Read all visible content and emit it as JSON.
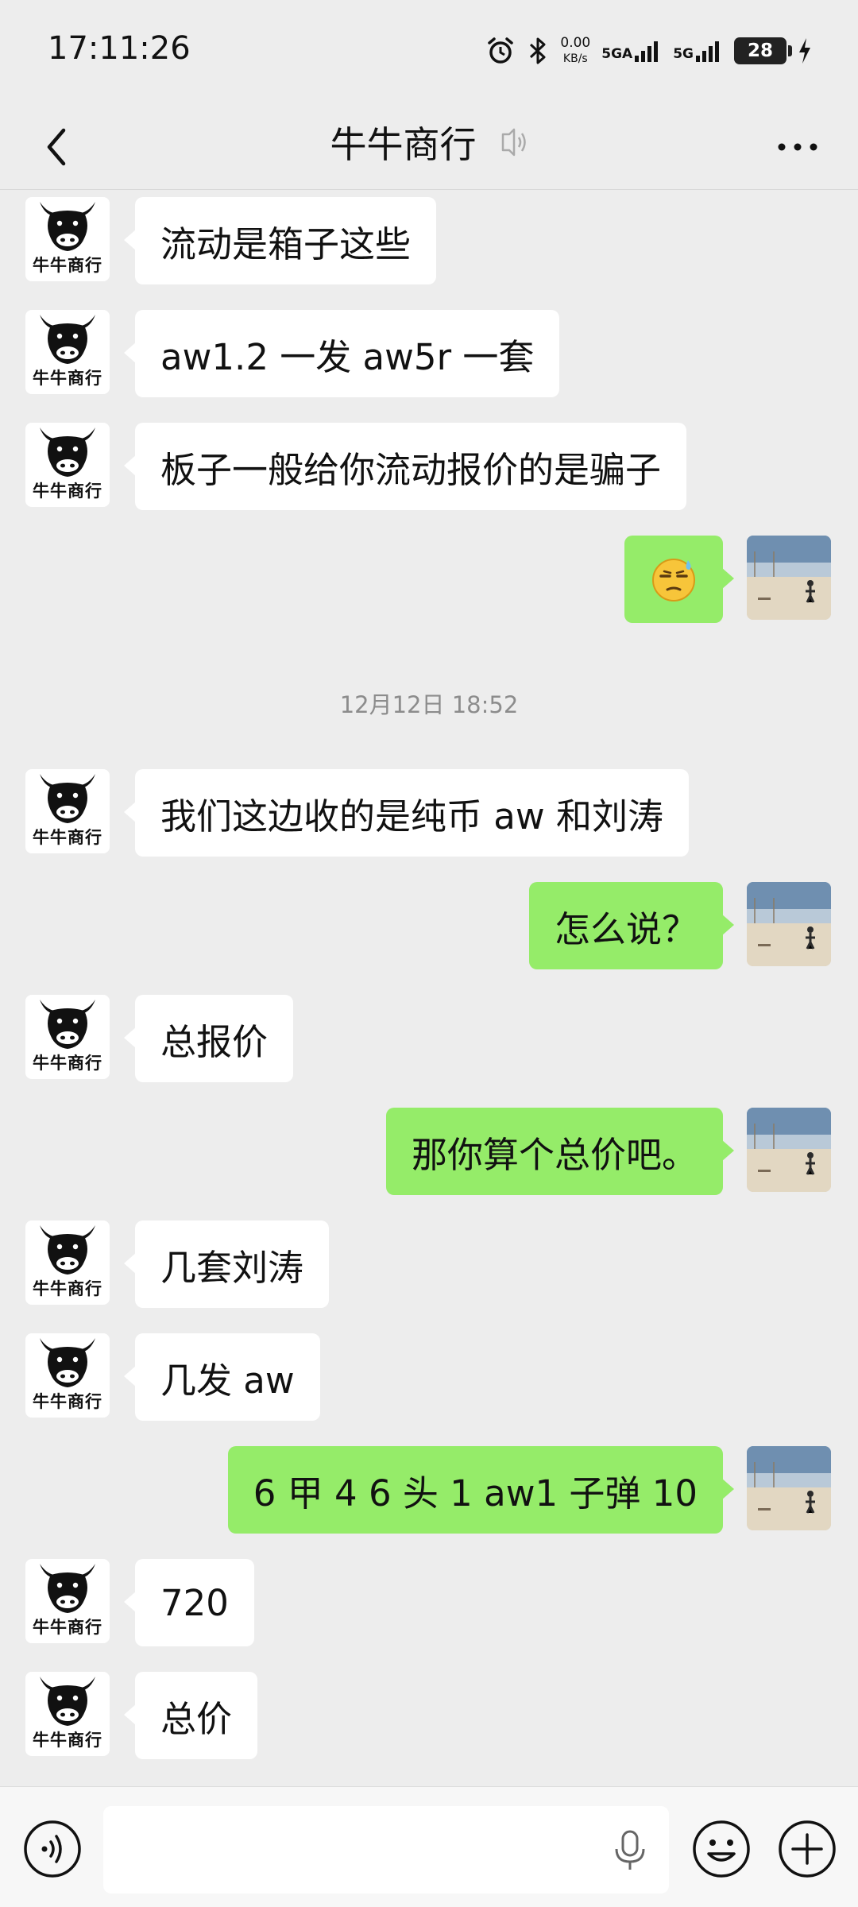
{
  "status_bar": {
    "time": "17:11:26",
    "net_speed_value": "0.00",
    "net_speed_unit": "KB/s",
    "signal_1_label": "5GA",
    "signal_2_label": "5G",
    "battery": "28",
    "icons": [
      "alarm-icon",
      "bluetooth-icon",
      "signal-icon",
      "charging-icon"
    ]
  },
  "header": {
    "title": "牛牛商行",
    "back_icon": "chevron-left-icon",
    "speaker_icon": "speaker-mode-icon",
    "more_icon": "more-dots-icon"
  },
  "contact": {
    "avatar_label": "牛牛商行"
  },
  "timestamp": "12月12日  18:52",
  "messages": [
    {
      "side": "in",
      "text": "流动是箱子这些"
    },
    {
      "side": "in",
      "text": "aw1.2 一发  aw5r 一套"
    },
    {
      "side": "in",
      "text": "板子一般给你流动报价的是骗子"
    },
    {
      "side": "out",
      "text": "",
      "emoji": "sweat-smile-emoji"
    },
    {
      "side": "in",
      "text": "我们这边收的是纯币 aw 和刘涛"
    },
    {
      "side": "out",
      "text": "怎么说？"
    },
    {
      "side": "in",
      "text": "总报价"
    },
    {
      "side": "out",
      "text": "那你算个总价吧。"
    },
    {
      "side": "in",
      "text": "几套刘涛"
    },
    {
      "side": "in",
      "text": "几发 aw"
    },
    {
      "side": "out",
      "text": "6 甲 4   6 头 1   aw1 子弹 10"
    },
    {
      "side": "in",
      "text": "720"
    },
    {
      "side": "in",
      "text": "总价"
    }
  ],
  "input_bar": {
    "placeholder": "",
    "value": "",
    "icons": [
      "voice-input-icon",
      "microphone-icon",
      "emoji-icon",
      "plus-icon"
    ]
  },
  "colors": {
    "background": "#ededed",
    "incoming_bubble": "#ffffff",
    "outgoing_bubble": "#95ec69",
    "timestamp_text": "#8c8c8c"
  }
}
